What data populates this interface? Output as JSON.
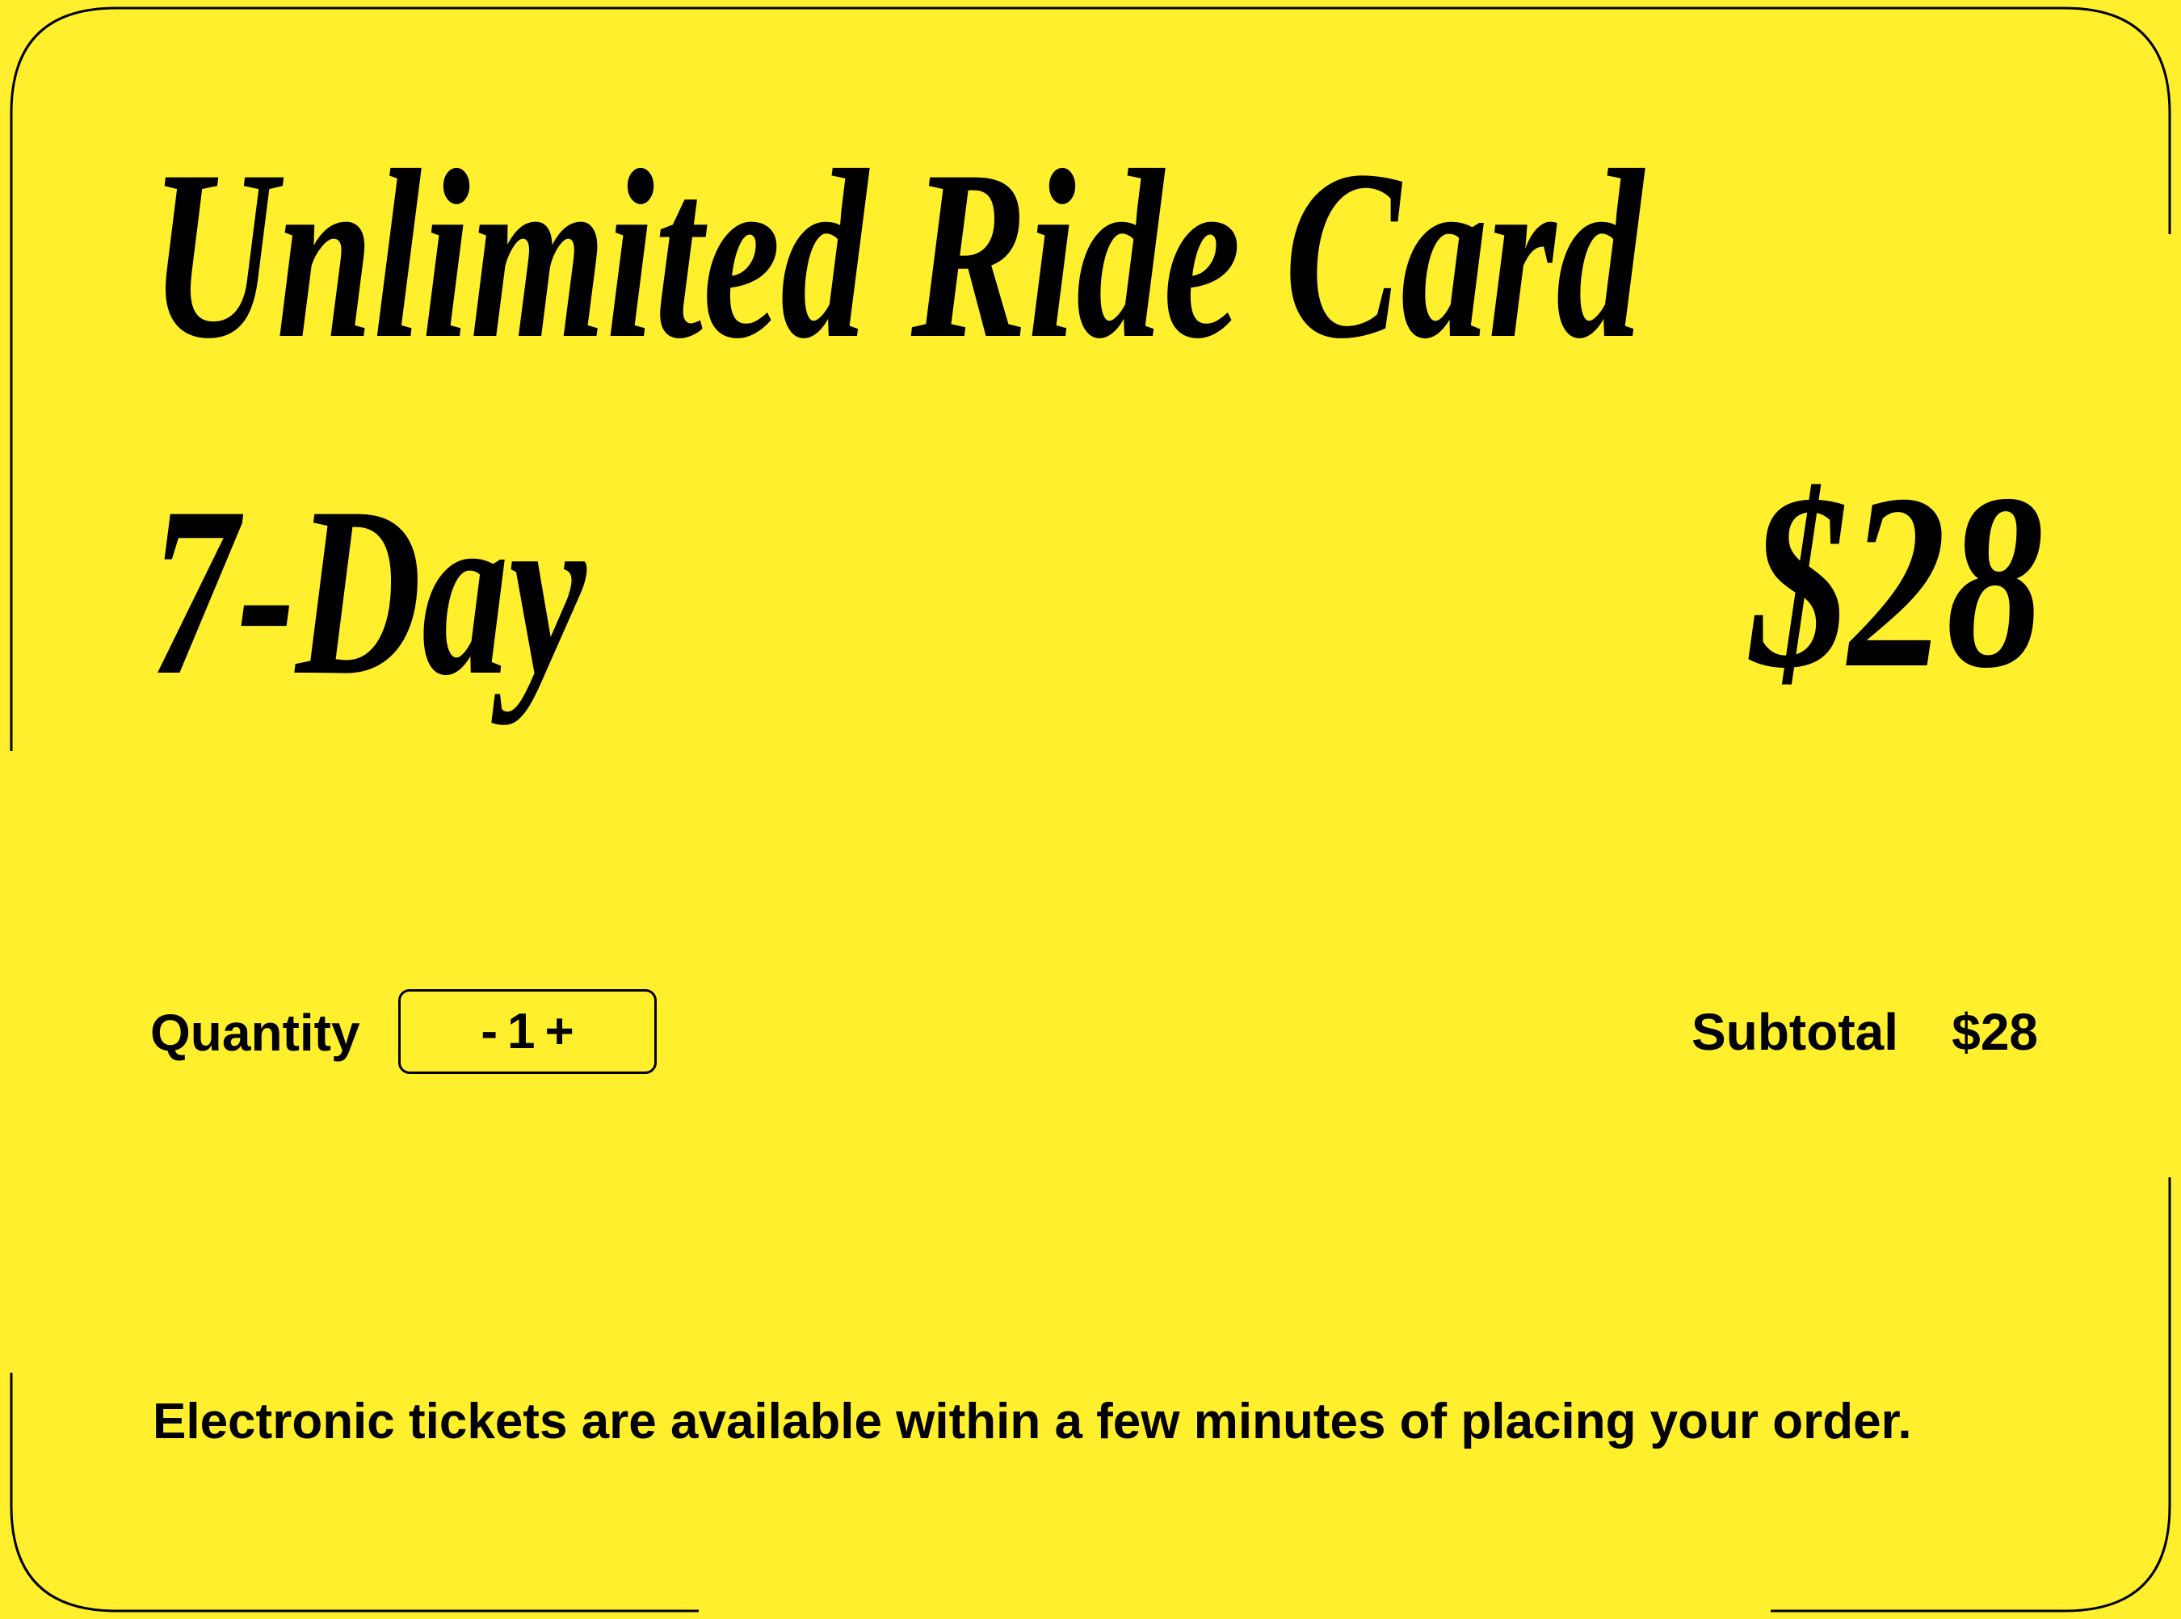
{
  "colors": {
    "background": "#FFEF2D",
    "text": "#000000",
    "border": "#000000"
  },
  "product": {
    "title_line1": "Unlimited Ride Card",
    "title_line2": "7-Day",
    "price": "$28"
  },
  "quantity": {
    "label": "Quantity",
    "decrement": "-",
    "value": "1",
    "increment": "+"
  },
  "subtotal": {
    "label": "Subtotal",
    "value": "$28"
  },
  "footer": {
    "note": "Electronic tickets are available within a few minutes of placing your order."
  }
}
